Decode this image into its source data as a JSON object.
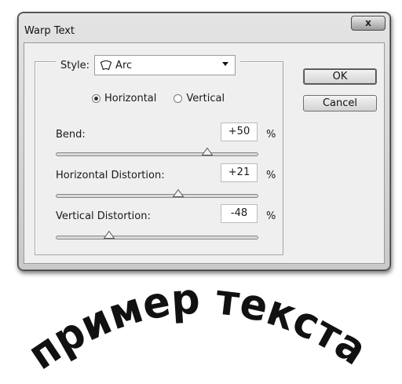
{
  "window": {
    "title": "Warp Text",
    "close_label": "x"
  },
  "dialog": {
    "style_label": "Style:",
    "style_value": "Arc",
    "orientation": {
      "horizontal_label": "Horizontal",
      "vertical_label": "Vertical",
      "selected": "Horizontal"
    },
    "bend": {
      "label": "Bend:",
      "value": "+50",
      "unit": "%",
      "level": 0.75
    },
    "horizontal_distortion": {
      "label": "Horizontal Distortion:",
      "value": "+21",
      "unit": "%",
      "level": 0.605
    },
    "vertical_distortion": {
      "label": "Vertical Distortion:",
      "value": "-48",
      "unit": "%",
      "level": 0.26
    }
  },
  "buttons": {
    "ok_label": "OK",
    "cancel_label": "Cancel"
  },
  "sample": {
    "text": "пример текста"
  }
}
